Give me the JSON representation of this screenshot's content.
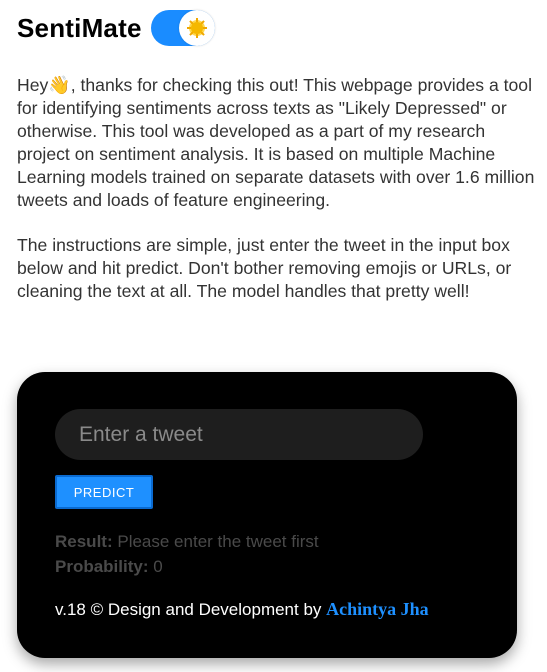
{
  "header": {
    "brand": "SentiMate",
    "theme_toggle": {
      "state": "on",
      "accent_color": "#1a8cff",
      "icon": "sun-icon"
    }
  },
  "intro": {
    "paragraph1_prefix": "Hey",
    "paragraph1_emoji": "👋",
    "paragraph1_rest": ", thanks for checking this out! This webpage provides a tool for identifying sentiments across texts as \"Likely Depressed\" or otherwise. This tool was developed as a part of my research project on sentiment analysis. It is based on multiple Machine Learning models trained on separate datasets with over 1.6 million tweets and loads of feature engineering.",
    "paragraph2": "The instructions are simple, just enter the tweet in the input box below and hit predict. Don't bother removing emojis or URLs, or cleaning the text at all. The model handles that pretty well!"
  },
  "card": {
    "tweet_input": {
      "placeholder": "Enter a tweet",
      "value": ""
    },
    "predict_label": "PREDICT",
    "result_label": "Result:",
    "result_value": "Please enter the tweet first",
    "probability_label": "Probability:",
    "probability_value": "0",
    "footer_text": "v.18 © Design and Development by",
    "author": "Achintya Jha"
  }
}
